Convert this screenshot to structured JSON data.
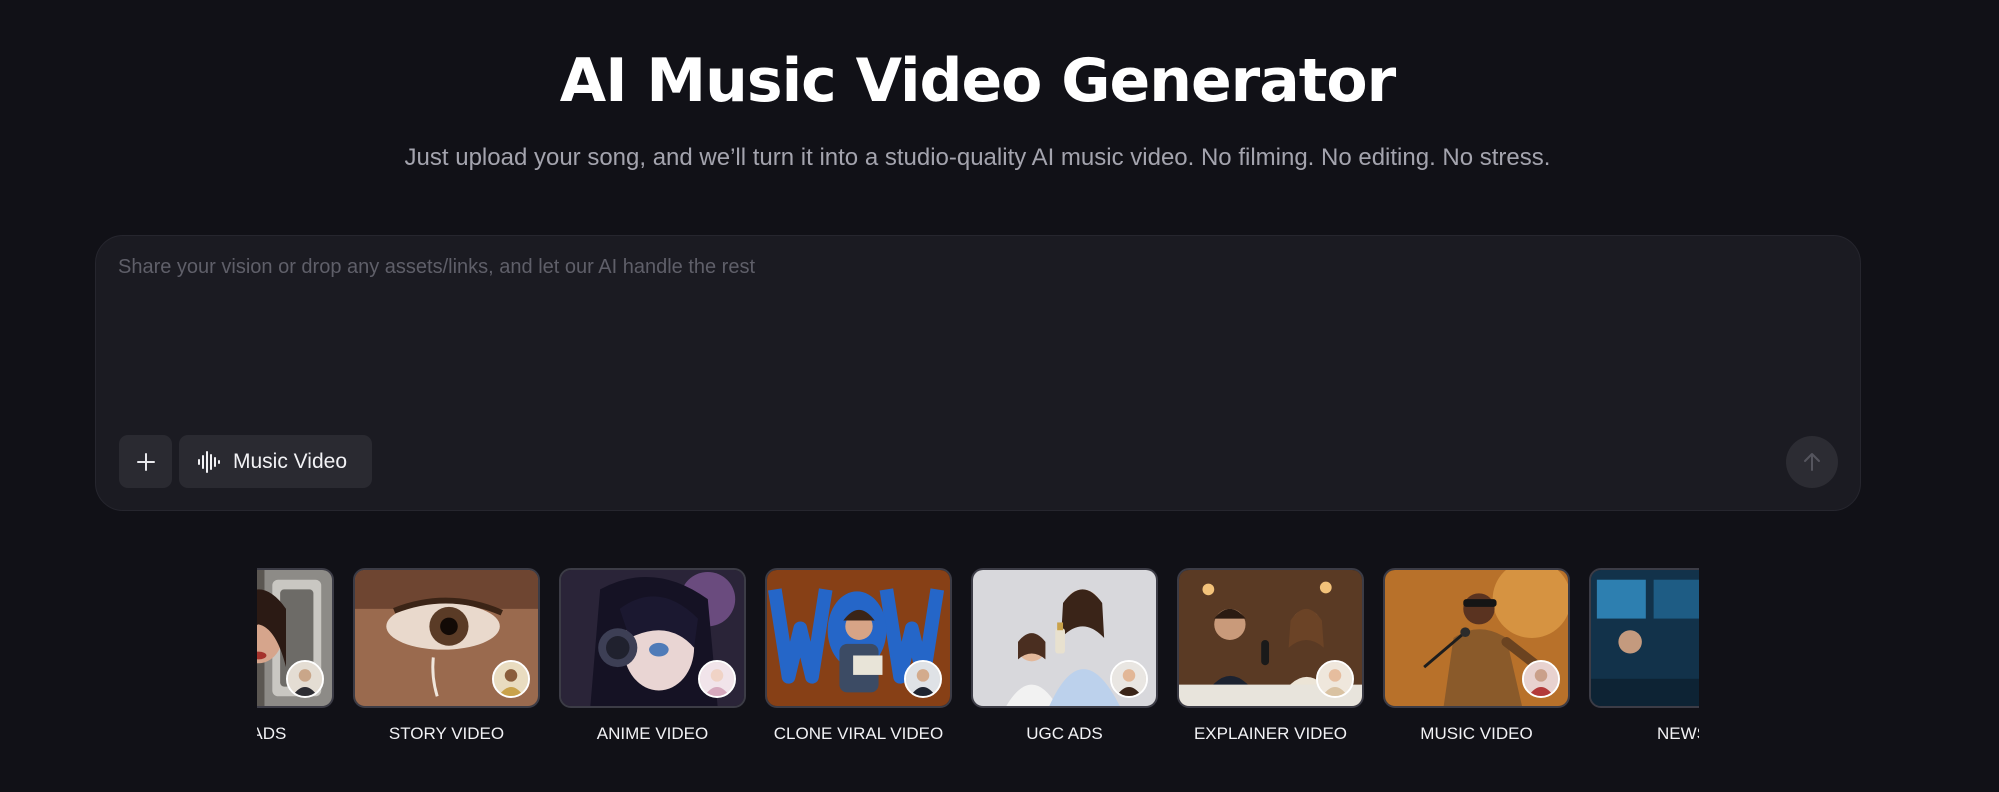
{
  "header": {
    "title": "AI Music Video Generator",
    "subtitle": "Just upload your song, and we’ll turn it into a studio-quality AI music video. No filming. No editing. No stress."
  },
  "prompt": {
    "placeholder": "Share your vision or drop any assets/links, and let our AI handle the rest",
    "value": "",
    "add_icon": "plus-icon",
    "mode_icon": "audio-waveform-icon",
    "mode_label": "Music Video",
    "send_icon": "arrow-up-icon"
  },
  "templates": [
    {
      "label": "VIDEO ADS",
      "visible_label": "DEO ADS",
      "thumb": "woman-in-car"
    },
    {
      "label": "STORY VIDEO",
      "thumb": "tearful-eye"
    },
    {
      "label": "ANIME VIDEO",
      "thumb": "anime-girl-headphones"
    },
    {
      "label": "CLONE VIRAL VIDEO",
      "thumb": "wow-reaction"
    },
    {
      "label": "UGC ADS",
      "thumb": "women-with-product"
    },
    {
      "label": "EXPLAINER VIDEO",
      "thumb": "podcast-hosts"
    },
    {
      "label": "MUSIC VIDEO",
      "thumb": "singer-on-stage"
    },
    {
      "label": "NEWS",
      "thumb": "newsroom"
    }
  ],
  "colors": {
    "background": "#111117",
    "panel": "#1b1b22",
    "button": "#2a2a31",
    "subtitle_text": "#a4a4ae",
    "placeholder_text": "#5f5f69"
  }
}
